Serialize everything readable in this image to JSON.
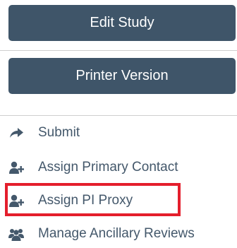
{
  "buttons": {
    "edit_study": "Edit Study",
    "printer_version": "Printer Version"
  },
  "actions": [
    {
      "label": "Submit",
      "icon": "share-arrow-icon"
    },
    {
      "label": "Assign Primary Contact",
      "icon": "user-plus-icon"
    },
    {
      "label": "Assign PI Proxy",
      "icon": "user-plus-icon"
    },
    {
      "label": "Manage Ancillary Reviews",
      "icon": "users-group-icon"
    }
  ],
  "highlighted_action": "Assign PI Proxy",
  "colors": {
    "button_bg": "#3f5569",
    "button_text": "#ffffff",
    "link_text": "#44586b",
    "highlight": "#e41e2c"
  }
}
